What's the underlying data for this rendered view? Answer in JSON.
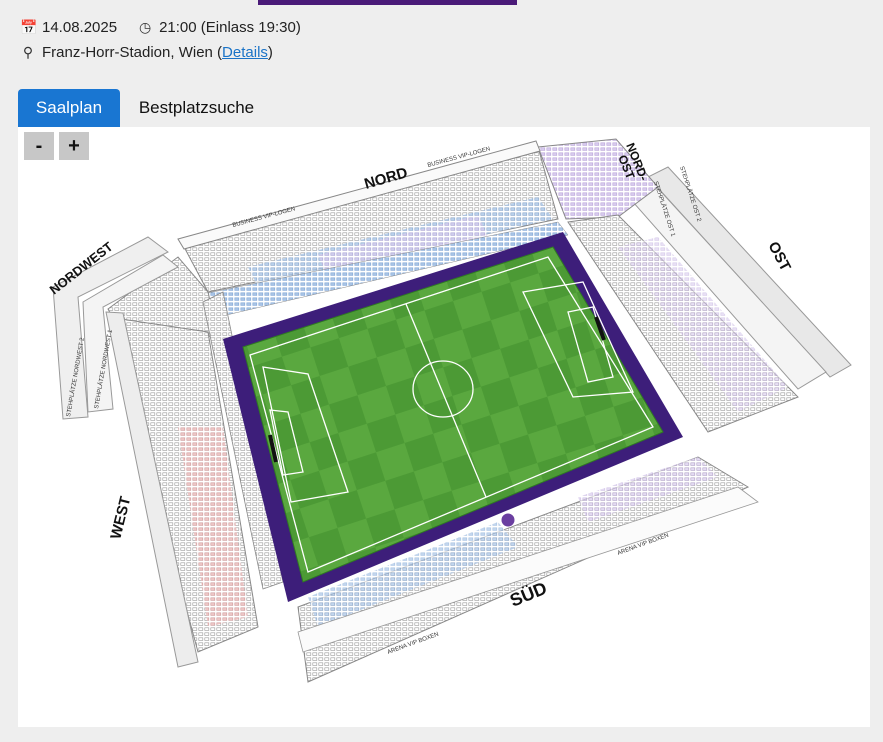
{
  "event": {
    "date": "14.08.2025",
    "time": "21:00 (Einlass 19:30)",
    "venue": "Franz-Horr-Stadion, Wien (",
    "details_link": "Details",
    "venue_close": ")"
  },
  "tabs": [
    {
      "label": "Saalplan",
      "active": true
    },
    {
      "label": "Bestplatzsuche",
      "active": false
    }
  ],
  "zoom": {
    "minus": "-",
    "plus": "+"
  },
  "stadium": {
    "sections": {
      "nord": "NORD",
      "nordost": "NORD-",
      "nordost2": "OST",
      "ost": "OST",
      "sued": "SÜD",
      "west": "WEST",
      "nordwest": "NORDWEST"
    },
    "labels": {
      "business_vip_left": "BUSINESS VIP-LOGEN",
      "business_vip_right": "BUSINESS VIP-LOGEN",
      "arena_vip_left": "ARENA VIP BOXEN",
      "arena_vip_right": "ARENA VIP BOXEN",
      "steh_ost1": "STEHPLÄTZE OST 1",
      "steh_ost2": "STEHPLÄTZE OST 2",
      "steh_nw1": "STEHPLÄTZE NORDWEST 1",
      "steh_nw2": "STEHPLÄTZE NORDWEST 2"
    },
    "colors": {
      "accent": "#4a1a78",
      "tab_active": "#1976d2",
      "pitch": "#4c9a35",
      "pitch_border": "#3d1e7a",
      "seat_blue": "#7fa6d6",
      "seat_lilac": "#b9a3d9",
      "seat_red": "#d39a9a"
    }
  }
}
